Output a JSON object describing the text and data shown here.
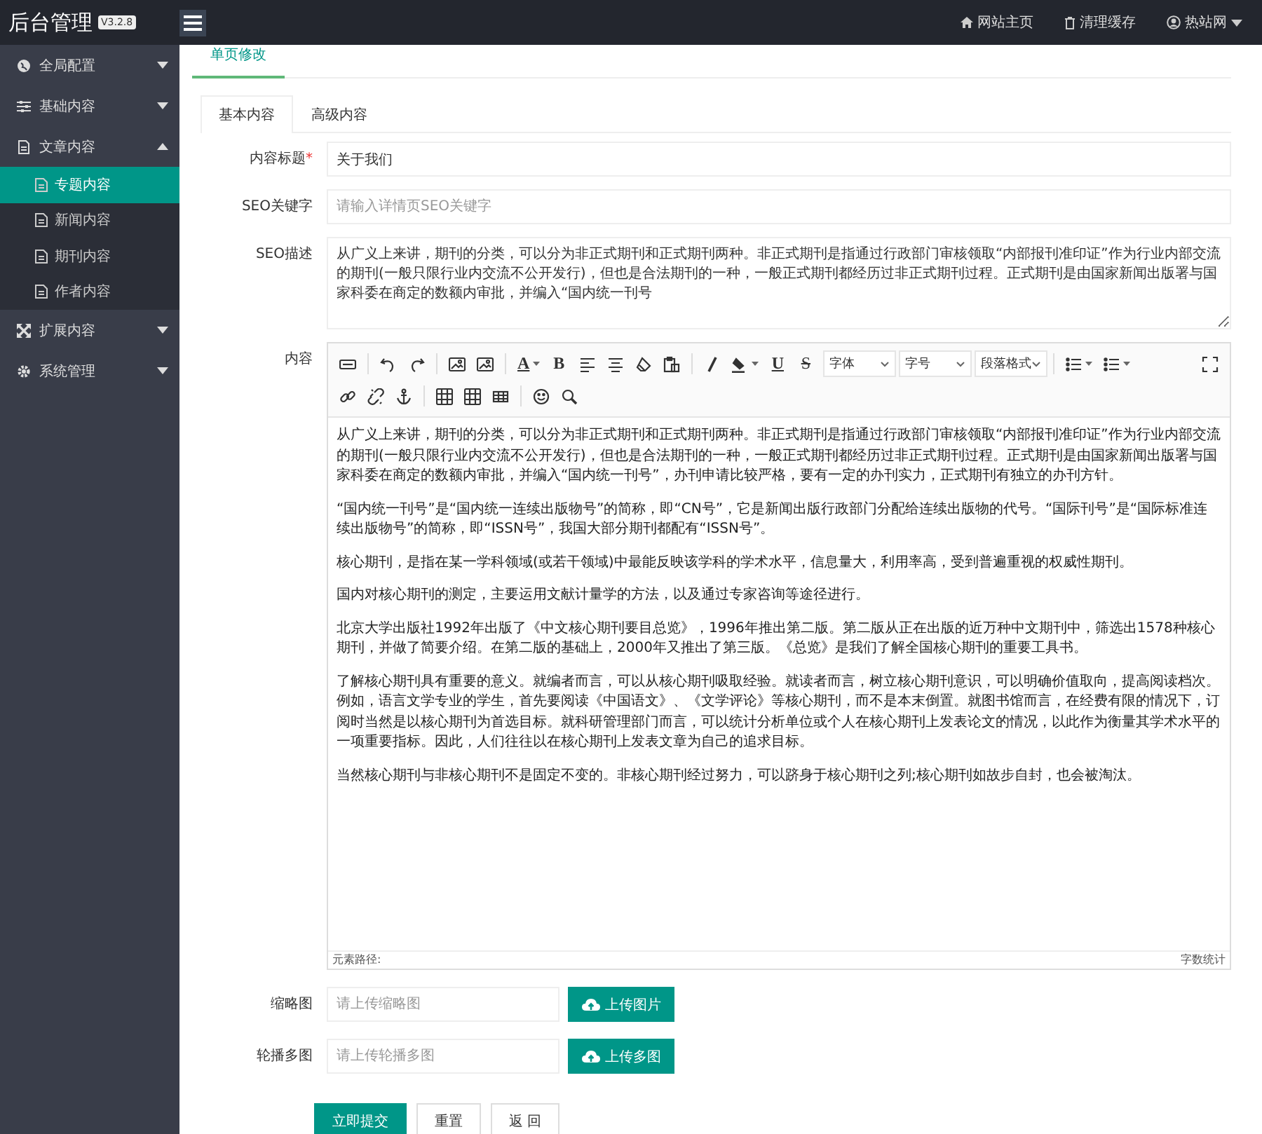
{
  "app": {
    "title": "后台管理",
    "version": "V3.2.8"
  },
  "topbar": {
    "links": [
      {
        "label": "网站主页"
      },
      {
        "label": "清理缓存"
      },
      {
        "label": "热站网"
      }
    ]
  },
  "sidebar": {
    "items": [
      {
        "label": "全局配置",
        "expanded": false
      },
      {
        "label": "基础内容",
        "expanded": false
      },
      {
        "label": "文章内容",
        "expanded": true,
        "children": [
          {
            "label": "专题内容",
            "selected": true
          },
          {
            "label": "新闻内容",
            "selected": false
          },
          {
            "label": "期刊内容",
            "selected": false
          },
          {
            "label": "作者内容",
            "selected": false
          }
        ]
      },
      {
        "label": "扩展内容",
        "expanded": false
      },
      {
        "label": "系统管理",
        "expanded": false
      }
    ]
  },
  "page_tab": {
    "label": "单页修改"
  },
  "form_tabs": [
    {
      "label": "基本内容",
      "selected": true
    },
    {
      "label": "高级内容",
      "selected": false
    }
  ],
  "fields": {
    "title": {
      "label": "内容标题",
      "required_mark": "*",
      "value": "关于我们"
    },
    "seo_keywords": {
      "label": "SEO关键字",
      "placeholder": "请输入详情页SEO关键字"
    },
    "seo_description": {
      "label": "SEO描述",
      "value": "从广义上来讲，期刊的分类，可以分为非正式期刊和正式期刊两种。非正式期刊是指通过行政部门审核领取“内部报刊准印证”作为行业内部交流的期刊(一般只限行业内交流不公开发行)，但也是合法期刊的一种，一般正式期刊都经历过非正式期刊过程。正式期刊是由国家新闻出版署与国家科委在商定的数额内审批，并编入“国内统一刊号"
    },
    "content": {
      "label": "内容"
    },
    "thumbnail": {
      "label": "缩略图",
      "placeholder": "请上传缩略图",
      "button": "上传图片"
    },
    "carousel": {
      "label": "轮播多图",
      "placeholder": "请上传轮播多图",
      "button": "上传多图"
    }
  },
  "editor": {
    "toolbar": [
      [
        {
          "kind": "source"
        },
        {
          "kind": "sep"
        },
        {
          "kind": "undo"
        },
        {
          "kind": "redo"
        },
        {
          "kind": "sep"
        },
        {
          "kind": "image"
        },
        {
          "kind": "picture"
        },
        {
          "kind": "sep"
        },
        {
          "kind": "fontcolor",
          "glyph": "A"
        },
        {
          "kind": "glyph",
          "glyph": "B"
        },
        {
          "kind": "alignleft"
        },
        {
          "kind": "aligncenter"
        },
        {
          "kind": "eraser"
        },
        {
          "kind": "paste"
        },
        {
          "kind": "sep"
        },
        {
          "kind": "italic"
        },
        {
          "kind": "bgcolor"
        },
        {
          "kind": "underline",
          "glyph": "U"
        },
        {
          "kind": "strike",
          "glyph": "S"
        },
        {
          "kind": "select",
          "label": "字体"
        },
        {
          "kind": "select",
          "label": "字号"
        },
        {
          "kind": "select",
          "label": "段落格式"
        },
        {
          "kind": "sep"
        },
        {
          "kind": "ol"
        },
        {
          "kind": "ul"
        },
        {
          "kind": "spacer"
        },
        {
          "kind": "fullscreen"
        }
      ],
      [
        {
          "kind": "link"
        },
        {
          "kind": "unlink"
        },
        {
          "kind": "anchor"
        },
        {
          "kind": "sep"
        },
        {
          "kind": "table"
        },
        {
          "kind": "tableadd"
        },
        {
          "kind": "tablerow"
        },
        {
          "kind": "sep"
        },
        {
          "kind": "emoji"
        },
        {
          "kind": "search"
        }
      ]
    ],
    "paragraphs": [
      "从广义上来讲，期刊的分类，可以分为非正式期刊和正式期刊两种。非正式期刊是指通过行政部门审核领取“内部报刊准印证”作为行业内部交流的期刊(一般只限行业内交流不公开发行)，但也是合法期刊的一种，一般正式期刊都经历过非正式期刊过程。正式期刊是由国家新闻出版署与国家科委在商定的数额内审批，并编入“国内统一刊号”，办刊申请比较严格，要有一定的办刊实力，正式期刊有独立的办刊方针。",
      "“国内统一刊号”是“国内统一连续出版物号”的简称，即“CN号”，它是新闻出版行政部门分配给连续出版物的代号。“国际刊号”是“国际标准连续出版物号”的简称，即“ISSN号”，我国大部分期刊都配有“ISSN号”。",
      "核心期刊，是指在某一学科领域(或若干领域)中最能反映该学科的学术水平，信息量大，利用率高，受到普遍重视的权威性期刊。",
      "国内对核心期刊的测定，主要运用文献计量学的方法，以及通过专家咨询等途径进行。",
      "北京大学出版社1992年出版了《中文核心期刊要目总览》，1996年推出第二版。第二版从正在出版的近万种中文期刊中，筛选出1578种核心期刊，并做了简要介绍。在第二版的基础上，2000年又推出了第三版。《总览》是我们了解全国核心期刊的重要工具书。",
      "了解核心期刊具有重要的意义。就编者而言，可以从核心期刊吸取经验。就读者而言，树立核心期刊意识，可以明确价值取向，提高阅读档次。例如，语言文学专业的学生，首先要阅读《中国语文》、《文学评论》等核心期刊，而不是本末倒置。就图书馆而言，在经费有限的情况下，订阅时当然是以核心期刊为首选目标。就科研管理部门而言，可以统计分析单位或个人在核心期刊上发表论文的情况，以此作为衡量其学术水平的一项重要指标。因此，人们往往以在核心期刊上发表文章为自己的追求目标。",
      "当然核心期刊与非核心期刊不是固定不变的。非核心期刊经过努力，可以跻身于核心期刊之列;核心期刊如故步自封，也会被淘汰。"
    ],
    "path_label": "元素路径:",
    "word_count": "字数统计"
  },
  "actions": [
    {
      "label": "立即提交",
      "kind": "primary"
    },
    {
      "label": "重置",
      "kind": "default"
    },
    {
      "label": "返 回",
      "kind": "default"
    }
  ]
}
